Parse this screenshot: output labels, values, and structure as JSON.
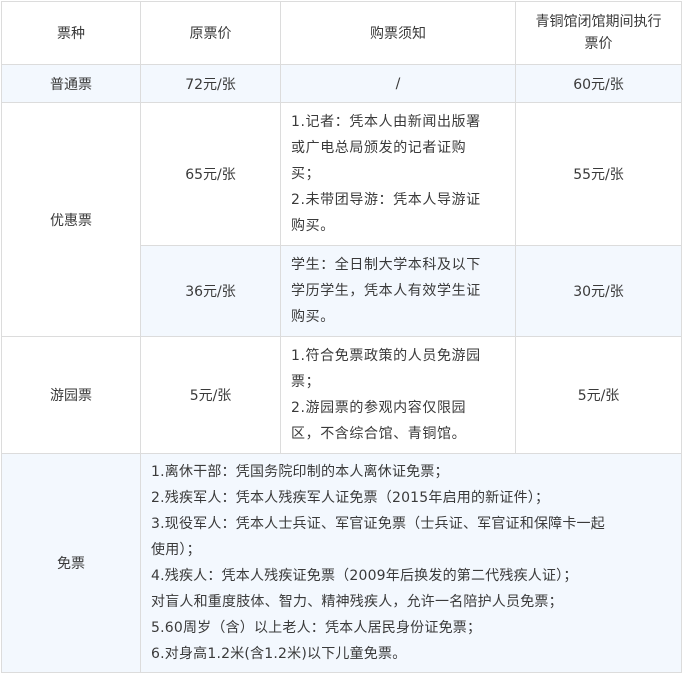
{
  "headers": [
    "票种",
    "原票价",
    "购票须知",
    "青铜馆闭馆期间执行\n票价"
  ],
  "header_lines": [
    "青铜馆闭馆期间执行",
    "票价"
  ],
  "rows": {
    "regular": {
      "type": "普通票",
      "original": "72元/张",
      "notice": "/",
      "closure": "60元/张"
    },
    "discount": {
      "type": "优惠票",
      "sub1": {
        "original": "65元/张",
        "notice_lines": [
          "1.记者：凭本人由新闻出版署",
          "或广电总局颁发的记者证购",
          "买；",
          "2.未带团导游：凭本人导游证",
          "购买。"
        ],
        "closure": "55元/张"
      },
      "sub2": {
        "original": "36元/张",
        "notice_lines": [
          "学生：全日制大学本科及以下",
          "学历学生，凭本人有效学生证",
          "购买。"
        ],
        "closure": "30元/张"
      }
    },
    "garden": {
      "type": "游园票",
      "original": "5元/张",
      "notice_lines": [
        "1.符合免票政策的人员免游园",
        "票；",
        "2.游园票的参观内容仅限园",
        "区，不含综合馆、青铜馆。"
      ],
      "closure": "5元/张"
    },
    "free": {
      "type": "免票",
      "lines": [
        "1.离休干部：凭国务院印制的本人离休证免票；",
        "2.残疾军人：凭本人残疾军人证免票（2015年启用的新证件）；",
        "3.现役军人：凭本人士兵证、军官证免票（士兵证、军官证和保障卡一起",
        "使用）；",
        "4.残疾人：凭本人残疾证免票（2009年后换发的第二代残疾人证）；",
        "对盲人和重度肢体、智力、精神残疾人，允许一名陪护人员免票；",
        "5.60周岁（含）以上老人：凭本人居民身份证免票；",
        "6.对身高1.2米(含1.2米)以下儿童免票。"
      ]
    }
  },
  "colors": {
    "shade": "#f3f8fe",
    "border": "#dcdcdc",
    "text": "#3a3a3a"
  }
}
